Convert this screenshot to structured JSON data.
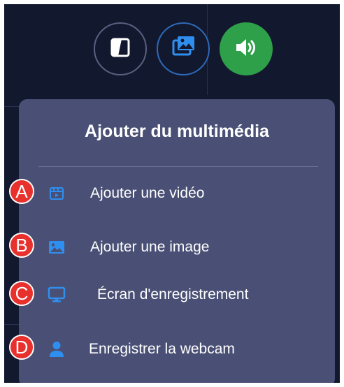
{
  "toolbar": {
    "buttons": [
      {
        "name": "theme-toggle",
        "icon": "contrast-icon"
      },
      {
        "name": "add-media",
        "icon": "media-gallery-icon"
      },
      {
        "name": "sound",
        "icon": "speaker-volume-icon"
      }
    ]
  },
  "panel": {
    "title": "Ajouter du multimédia",
    "items": [
      {
        "badge": "A",
        "icon": "video-clapper-icon",
        "label": "Ajouter une vidéo"
      },
      {
        "badge": "B",
        "icon": "image-icon",
        "label": "Ajouter une image"
      },
      {
        "badge": "C",
        "icon": "monitor-icon",
        "label": "Écran d'enregistrement"
      },
      {
        "badge": "D",
        "icon": "person-icon",
        "label": "Enregistrer la webcam"
      }
    ]
  },
  "colors": {
    "background": "#12182e",
    "panel": "#4a5075",
    "icon_accent": "#2f8ff0",
    "sound_button": "#2ea04a",
    "badge": "#e8302c"
  }
}
